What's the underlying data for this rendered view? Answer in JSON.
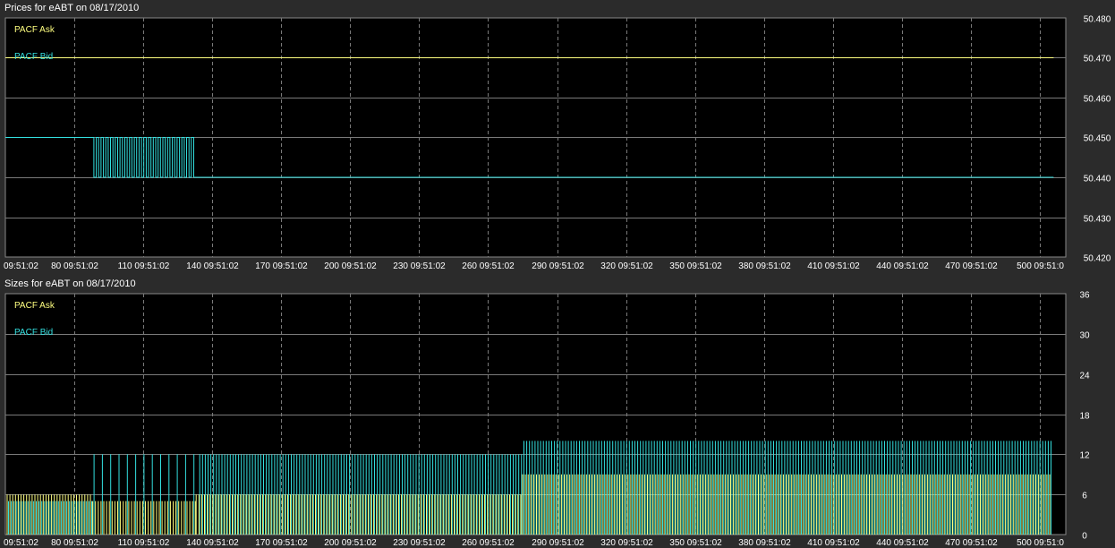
{
  "colors": {
    "ask": "#ffff80",
    "bid": "#33e0e0",
    "grid": "#7a7a7a",
    "plot_bg": "#000000",
    "frame_bg": "#2b2b2b",
    "text": "#ffffff"
  },
  "chart_data": [
    {
      "type": "line",
      "title": "Prices for  eABT  on  08/17/2010",
      "x_tick_labels": [
        "09:51:02",
        "80 09:51:02",
        "110 09:51:02",
        "140 09:51:02",
        "170 09:51:02",
        "200 09:51:02",
        "230 09:51:02",
        "260 09:51:02",
        "290 09:51:02",
        "320 09:51:02",
        "350 09:51:02",
        "380 09:51:02",
        "410 09:51:02",
        "440 09:51:02",
        "470 09:51:02",
        "500 09:51:0"
      ],
      "x": [
        50,
        80,
        110,
        140,
        170,
        200,
        230,
        260,
        290,
        320,
        350,
        380,
        410,
        440,
        470,
        500
      ],
      "xlim": [
        49,
        510
      ],
      "ylim": [
        50.42,
        50.48
      ],
      "y_tick_labels": [
        "50.480",
        "50.470",
        "50.460",
        "50.450",
        "50.440",
        "50.430",
        "50.420"
      ],
      "y_ticks": [
        50.48,
        50.47,
        50.46,
        50.45,
        50.44,
        50.43,
        50.42
      ],
      "grid": true,
      "legend": [
        "PACF Ask",
        "PACF Bid"
      ],
      "legend_placement": "top-left",
      "series": [
        {
          "name": "PACF Ask",
          "segments": [
            {
              "x0": 50,
              "x1": 506,
              "y": 50.47
            }
          ]
        },
        {
          "name": "PACF Bid",
          "segments": [
            {
              "x0": 50,
              "x1": 87.5,
              "y": 50.45
            },
            {
              "x0": 87.5,
              "x1": 133,
              "y_alternating": [
                50.45,
                50.44
              ],
              "count": 44
            },
            {
              "x0": 133,
              "x1": 506,
              "y": 50.44
            }
          ]
        }
      ]
    },
    {
      "type": "bar",
      "title": "Sizes for  eABT  on  08/17/2010",
      "x_tick_labels": [
        "09:51:02",
        "80 09:51:02",
        "110 09:51:02",
        "140 09:51:02",
        "170 09:51:02",
        "200 09:51:02",
        "230 09:51:02",
        "260 09:51:02",
        "290 09:51:02",
        "320 09:51:02",
        "350 09:51:02",
        "380 09:51:02",
        "410 09:51:02",
        "440 09:51:02",
        "470 09:51:02",
        "500 09:51:0"
      ],
      "x": [
        50,
        80,
        110,
        140,
        170,
        200,
        230,
        260,
        290,
        320,
        350,
        380,
        410,
        440,
        470,
        500
      ],
      "xlim": [
        49,
        510
      ],
      "ylim": [
        0,
        36
      ],
      "y_tick_labels": [
        "36",
        "30",
        "24",
        "18",
        "12",
        "6",
        "0"
      ],
      "y_ticks": [
        36,
        30,
        24,
        18,
        12,
        6,
        0
      ],
      "grid": true,
      "legend": [
        "PACF Ask",
        "PACF Bid"
      ],
      "legend_placement": "top-left",
      "series": [
        {
          "name": "PACF Ask",
          "segments": [
            {
              "x0": 50,
              "x1": 88,
              "value": 6
            },
            {
              "x0": 88,
              "x1": 133,
              "value": 5
            },
            {
              "x0": 133,
              "x1": 275,
              "value": 6
            },
            {
              "x0": 275,
              "x1": 505,
              "value": 9
            }
          ]
        },
        {
          "name": "PACF Bid",
          "segments": [
            {
              "x0": 50,
              "x1": 88,
              "value": 5
            },
            {
              "x0": 88,
              "x1": 134,
              "value": 12,
              "sparse": true
            },
            {
              "x0": 134,
              "x1": 275,
              "value": 12
            },
            {
              "x0": 275,
              "x1": 505,
              "value": 14
            }
          ]
        }
      ]
    }
  ]
}
